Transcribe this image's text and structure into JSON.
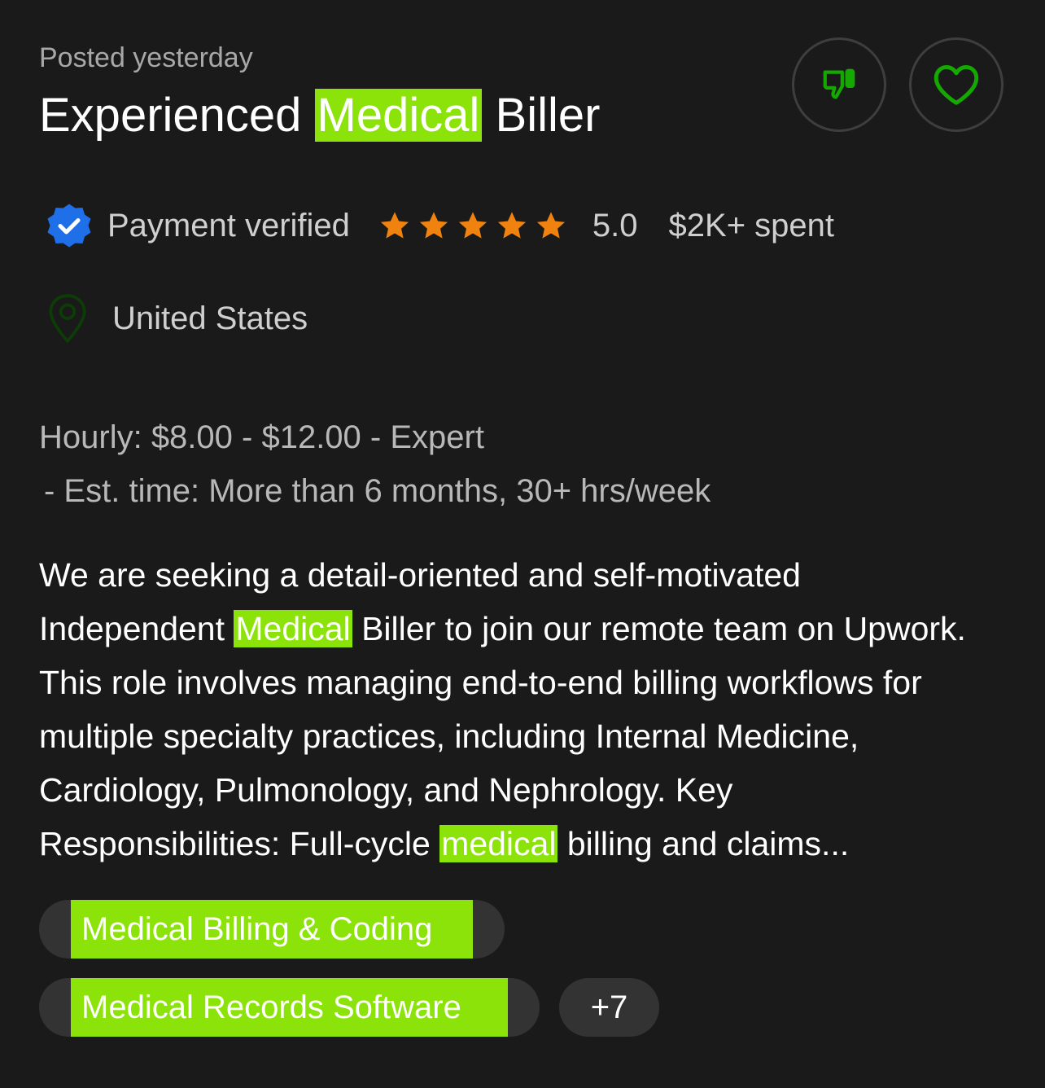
{
  "posted": "Posted yesterday",
  "title": {
    "before": "Experienced ",
    "highlight": "Medical",
    "after": " Biller"
  },
  "actions": {
    "dislike_icon": "thumbs-down-icon",
    "like_icon": "heart-icon"
  },
  "client": {
    "payment_status": "Payment verified",
    "rating_stars": 5,
    "rating": "5.0",
    "spent": "$2K+ spent",
    "location": "United States"
  },
  "budget": {
    "line1": "Hourly: $8.00 - $12.00 - Expert",
    "line2": "- Est. time: More than 6 months, 30+ hrs/week"
  },
  "description": {
    "l1": "We are seeking a detail-oriented and self-motivated",
    "l2_before": "Independent ",
    "l2_highlight": "Medical",
    "l2_after": " Biller to join our remote team on Upwork.",
    "l3": "This role involves managing end-to-end billing workflows for",
    "l4": "multiple specialty practices, including Internal Medicine,",
    "l5": "Cardiology, Pulmonology, and Nephrology. Key",
    "l6_before": "Responsibilities: Full-cycle ",
    "l6_highlight": "medical",
    "l6_after": " billing and claims..."
  },
  "skills": [
    "Medical Billing & Coding",
    "Medical Records Software"
  ],
  "more_skills": "+7",
  "colors": {
    "background": "#1a1a1a",
    "highlight": "#8be309",
    "star": "#f0820f",
    "verified": "#1f6fe8",
    "icon_green": "#14a800"
  }
}
